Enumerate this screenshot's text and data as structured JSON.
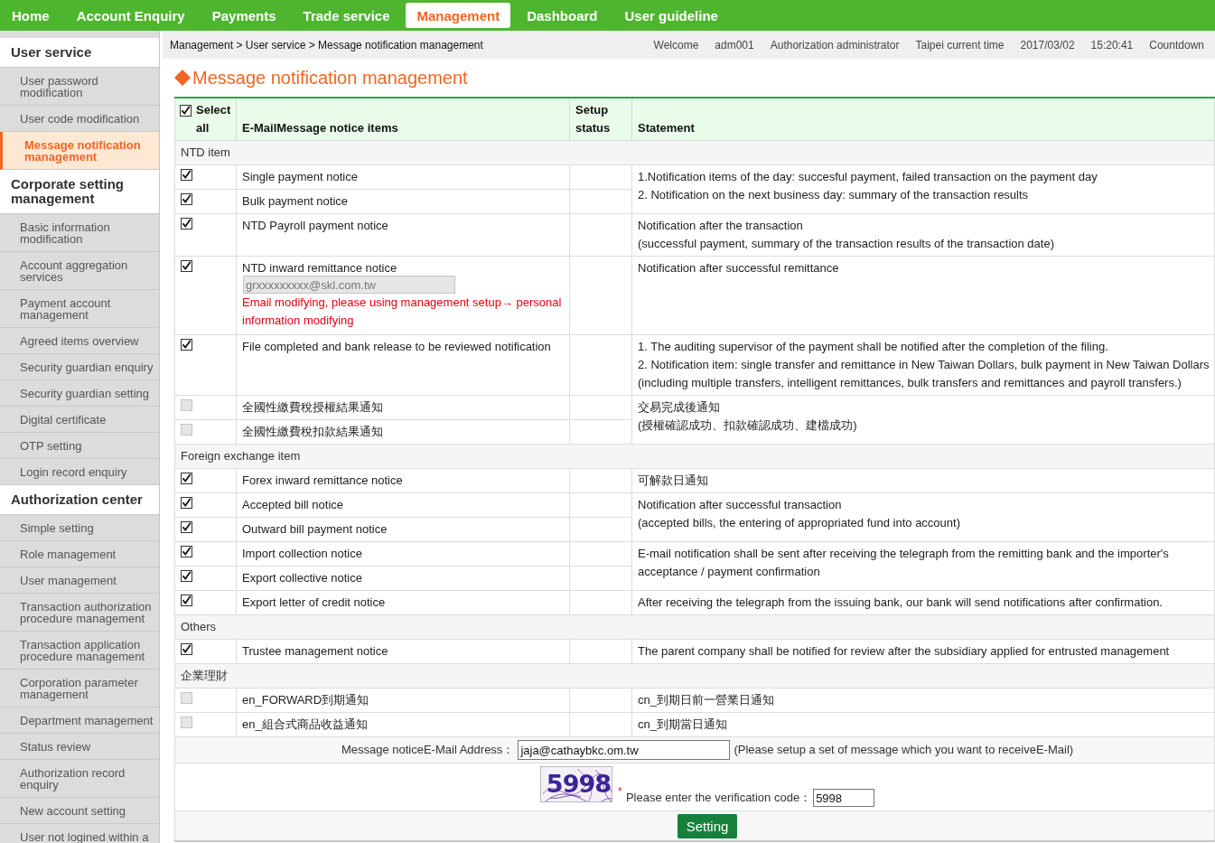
{
  "nav": {
    "items": [
      {
        "label": "Home",
        "selected": false
      },
      {
        "label": "Account Enquiry",
        "selected": false
      },
      {
        "label": "Payments",
        "selected": false
      },
      {
        "label": "Trade service",
        "selected": false
      },
      {
        "label": "Management",
        "selected": true
      },
      {
        "label": "Dashboard",
        "selected": false
      },
      {
        "label": "User guideline",
        "selected": false
      }
    ]
  },
  "breadcrumb": "Management > User service > Message notification management",
  "header_info": {
    "greeting": "Welcome",
    "user_id": "adm001",
    "role": "Authorization administrator",
    "time_label": "Taipei current time",
    "date": "2017/03/02",
    "time": "15:20:41",
    "countdown": "Countdown"
  },
  "sidebar": {
    "sections": [
      {
        "title": "User service",
        "items": [
          {
            "label": "User password modification",
            "selected": false
          },
          {
            "label": "User code modification",
            "selected": false
          },
          {
            "label": "Message notification management",
            "selected": true
          }
        ]
      },
      {
        "title": "Corporate setting management",
        "items": [
          {
            "label": "Basic information modification",
            "selected": false
          },
          {
            "label": "Account aggregation services",
            "selected": false
          },
          {
            "label": "Payment account management",
            "selected": false
          },
          {
            "label": "Agreed items overview",
            "selected": false
          },
          {
            "label": "Security guardian enquiry",
            "selected": false
          },
          {
            "label": "Security guardian setting",
            "selected": false
          },
          {
            "label": "Digital certificate",
            "selected": false
          },
          {
            "label": "OTP setting",
            "selected": false
          },
          {
            "label": "Login record enquiry",
            "selected": false
          }
        ]
      },
      {
        "title": "Authorization center",
        "items": [
          {
            "label": "Simple setting",
            "selected": false
          },
          {
            "label": "Role management",
            "selected": false
          },
          {
            "label": "User management",
            "selected": false
          },
          {
            "label": "Transaction authorization procedure management",
            "selected": false
          },
          {
            "label": "Transaction application procedure management",
            "selected": false
          },
          {
            "label": "Corporation parameter management",
            "selected": false
          },
          {
            "label": "Department management",
            "selected": false
          },
          {
            "label": "Status review",
            "selected": false
          },
          {
            "label": "Authorization record enquiry",
            "selected": false
          },
          {
            "label": "New account setting",
            "selected": false
          },
          {
            "label": "User not logined within a",
            "selected": false
          }
        ]
      }
    ]
  },
  "page_title": "Message notification management",
  "table": {
    "select_all": {
      "label": "Select all",
      "checked": true
    },
    "columns": [
      "E-MailMessage notice items",
      "Setup status",
      "Statement"
    ],
    "groups": [
      {
        "title": "NTD item",
        "blocks": [
          {
            "rows": [
              {
                "label": "Single payment notice",
                "checked": true,
                "disabled": false
              },
              {
                "label": "Bulk payment notice",
                "checked": true,
                "disabled": false
              }
            ],
            "statement": [
              "1.Notification items of the day: succesful payment, failed transaction on the payment day",
              "2. Notification on the next business day: summary of the transaction results"
            ]
          },
          {
            "rows": [
              {
                "label": "NTD Payroll payment notice",
                "checked": true,
                "disabled": false
              }
            ],
            "statement": [
              "Notification after the transaction",
              "(successful payment, summary of the transaction results of the transaction date)"
            ]
          },
          {
            "rows": [
              {
                "label": "NTD inward remittance notice",
                "checked": true,
                "disabled": false,
                "email": {
                  "value": "grxxxxxxxxx@skl.com.tw",
                  "disabled": true
                },
                "warning": "Email modifying, please using management setup→ personal information modifying"
              }
            ],
            "statement": [
              "Notification after successful remittance"
            ]
          },
          {
            "rows": [
              {
                "label": "File completed and bank release to be reviewed notification",
                "checked": true,
                "disabled": false
              }
            ],
            "statement": [
              "1. The auditing supervisor of the payment shall be notified after the completion of the filing.",
              "2. Notification item: single transfer and remittance in New Taiwan Dollars, bulk payment in New Taiwan Dollars",
              "(including multiple transfers, intelligent remittances, bulk transfers and remittances and payroll transfers.)"
            ]
          },
          {
            "rows": [
              {
                "label": "全國性繳費稅授權結果通知",
                "checked": false,
                "disabled": true
              },
              {
                "label": "全國性繳費稅扣款結果通知",
                "checked": false,
                "disabled": true
              }
            ],
            "statement": [
              "交易完成後通知",
              "(授權確認成功、扣款確認成功、建檔成功)"
            ]
          }
        ]
      },
      {
        "title": "Foreign exchange item",
        "blocks": [
          {
            "rows": [
              {
                "label": "Forex inward remittance notice",
                "checked": true,
                "disabled": false
              }
            ],
            "statement": [
              "可解款日通知"
            ]
          },
          {
            "rows": [
              {
                "label": "Accepted bill notice",
                "checked": true,
                "disabled": false
              },
              {
                "label": "Outward bill payment notice",
                "checked": true,
                "disabled": false
              }
            ],
            "statement": [
              "Notification after successful transaction",
              "(accepted bills, the entering of appropriated fund into account)"
            ]
          },
          {
            "rows": [
              {
                "label": "Import collection notice",
                "checked": true,
                "disabled": false
              },
              {
                "label": "Export collective notice",
                "checked": true,
                "disabled": false
              }
            ],
            "statement": [
              "E-mail notification shall be sent after receiving the telegraph from the remitting bank and the importer's acceptance / payment confirmation"
            ]
          },
          {
            "rows": [
              {
                "label": "Export letter of credit notice",
                "checked": true,
                "disabled": false
              }
            ],
            "statement": [
              "After receiving the telegraph from the issuing bank, our bank will send notifications after confirmation."
            ]
          }
        ]
      },
      {
        "title": "Others",
        "blocks": [
          {
            "rows": [
              {
                "label": "Trustee management notice",
                "checked": true,
                "disabled": false
              }
            ],
            "statement": [
              "The parent company shall be notified for review after the subsidiary applied for entrusted management"
            ]
          }
        ]
      },
      {
        "title": "企業理財",
        "blocks": [
          {
            "rows": [
              {
                "label": "en_FORWARD到期通知",
                "checked": false,
                "disabled": true
              }
            ],
            "statement": [
              "cn_到期日前一營業日通知"
            ]
          },
          {
            "rows": [
              {
                "label": "en_組合式商品收益通知",
                "checked": false,
                "disabled": true
              }
            ],
            "statement": [
              "cn_到期當日通知"
            ]
          }
        ]
      }
    ]
  },
  "email_setting": {
    "label": "Message noticeE-Mail Address：",
    "value": "jaja@cathaybkc.om.tw",
    "hint": "(Please setup a set of message which you want to receiveE-Mail)"
  },
  "verification": {
    "captcha": "5998",
    "required_mark": "*",
    "label": "Please enter the verification code：",
    "value": "5998"
  },
  "submit": {
    "label": "Setting"
  }
}
